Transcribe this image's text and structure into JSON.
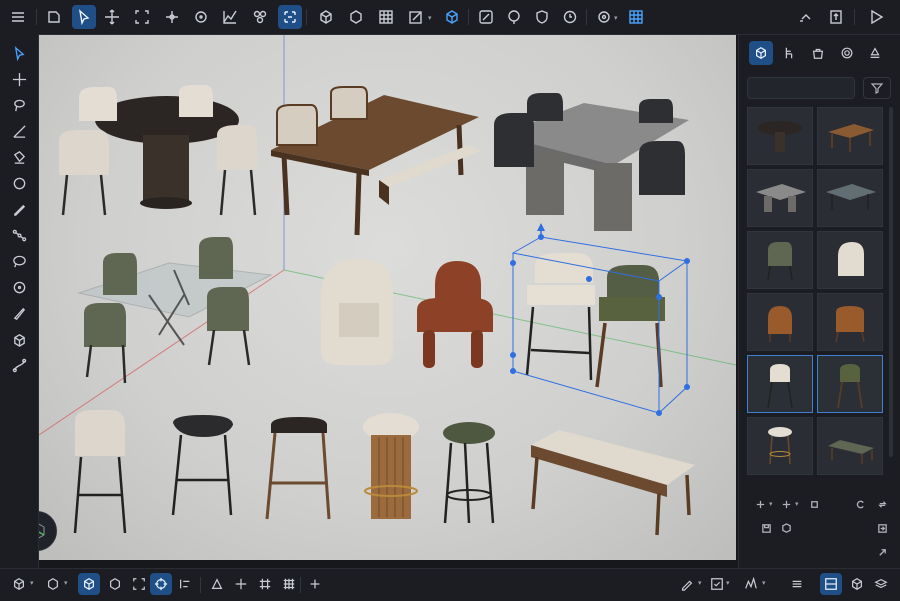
{
  "app": {
    "colors": {
      "accent": "#1f4f86",
      "selection": "#2f6fe0",
      "bg": "#16181c",
      "panel": "#1b1d22"
    }
  },
  "toolbar": {
    "items": [
      {
        "icon": "menu-icon"
      },
      {
        "icon": "new-object-icon"
      },
      {
        "icon": "select-icon",
        "active": true
      },
      {
        "icon": "move-icon"
      },
      {
        "icon": "scale-icon"
      },
      {
        "icon": "transform-icon"
      },
      {
        "icon": "rotate-icon"
      },
      {
        "icon": "curve-icon"
      },
      {
        "icon": "nodes-icon"
      },
      {
        "icon": "snap-icon",
        "active": true
      },
      {
        "icon": "cube-icon"
      },
      {
        "icon": "box-icon"
      },
      {
        "icon": "grid-icon"
      },
      {
        "icon": "edit-icon"
      },
      {
        "icon": "cube-solid-icon"
      },
      {
        "icon": "pencil-icon"
      },
      {
        "icon": "location-icon"
      },
      {
        "icon": "shield-icon"
      },
      {
        "icon": "clock-icon"
      },
      {
        "icon": "settings-icon"
      },
      {
        "icon": "layout-grid-icon"
      },
      {
        "icon": "redo-icon"
      },
      {
        "icon": "export-icon"
      },
      {
        "icon": "play-icon"
      }
    ]
  },
  "left_tools": [
    {
      "icon": "select-arrow-icon",
      "active": true
    },
    {
      "icon": "move-tool-icon"
    },
    {
      "icon": "lasso-icon"
    },
    {
      "icon": "measure-icon"
    },
    {
      "icon": "paint-icon"
    },
    {
      "icon": "circle-select-icon"
    },
    {
      "icon": "draw-icon"
    },
    {
      "icon": "path-icon"
    },
    {
      "icon": "comment-icon"
    },
    {
      "icon": "target-icon"
    },
    {
      "icon": "knife-icon"
    },
    {
      "icon": "extrude-icon"
    },
    {
      "icon": "curve-tool-icon"
    }
  ],
  "panel": {
    "tabs": [
      {
        "icon": "assets-cube-icon",
        "active": true
      },
      {
        "icon": "chair-icon"
      },
      {
        "icon": "bag-icon"
      },
      {
        "icon": "material-icon"
      },
      {
        "icon": "lamp-icon"
      }
    ],
    "search": {
      "placeholder": "",
      "value": ""
    },
    "filter_icon": "filter-icon",
    "assets": [
      {
        "name": "round-dining-table",
        "selected": false
      },
      {
        "name": "wood-table",
        "selected": false
      },
      {
        "name": "marble-table",
        "selected": false
      },
      {
        "name": "glass-table",
        "selected": false
      },
      {
        "name": "green-dining-chair",
        "selected": false
      },
      {
        "name": "boucle-chair",
        "selected": false
      },
      {
        "name": "rust-chair",
        "selected": false
      },
      {
        "name": "wood-armchair",
        "selected": false
      },
      {
        "name": "cream-bar-stool",
        "selected": true
      },
      {
        "name": "green-bar-stool",
        "selected": true
      },
      {
        "name": "cushion-stool",
        "selected": false
      },
      {
        "name": "green-bench",
        "selected": false
      }
    ],
    "footer_icons": [
      "add-icon",
      "add-icon",
      "collapse-icon",
      "refresh-icon",
      "sync-icon",
      "save-icon",
      "box-icon",
      "import-icon",
      "expand-icon"
    ]
  },
  "bottom": {
    "items": [
      {
        "icon": "view-cube-icon"
      },
      {
        "icon": "shading-icon"
      },
      {
        "icon": "cube-active-icon",
        "active": true
      },
      {
        "icon": "wire-icon"
      },
      {
        "icon": "frame-icon"
      },
      {
        "icon": "snap-rotate-icon"
      },
      {
        "icon": "target-active-icon",
        "active": true
      },
      {
        "icon": "align-icon"
      },
      {
        "icon": "triangle-icon"
      },
      {
        "icon": "axis-icon"
      },
      {
        "icon": "grid-small-icon"
      },
      {
        "icon": "grid-big-icon"
      },
      {
        "icon": "plus-icon"
      },
      {
        "icon": "edit-mode-icon"
      },
      {
        "icon": "check-icon"
      },
      {
        "icon": "chart-icon"
      },
      {
        "icon": "stack-icon"
      },
      {
        "icon": "layout-active-icon",
        "active": true
      },
      {
        "icon": "render-icon"
      },
      {
        "icon": "layers-icon"
      }
    ]
  }
}
